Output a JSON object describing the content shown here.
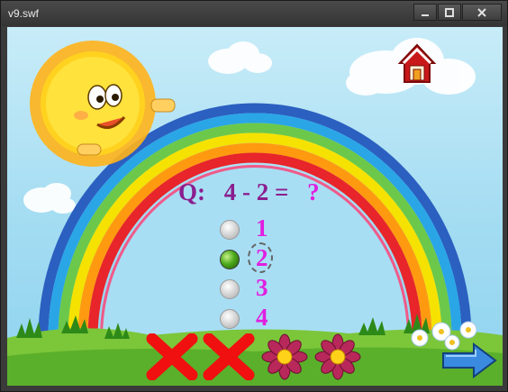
{
  "window": {
    "title": "v9.swf",
    "minimize_icon": "minimize-icon",
    "maximize_icon": "maximize-icon",
    "close_icon": "close-icon"
  },
  "question": {
    "prefix": "Q:",
    "expression": "4 - 2 =",
    "unknown": "?"
  },
  "options": [
    {
      "label": "1",
      "selected": false
    },
    {
      "label": "2",
      "selected": true
    },
    {
      "label": "3",
      "selected": false
    },
    {
      "label": "4",
      "selected": false
    }
  ],
  "progress": [
    {
      "state": "wrong",
      "icon": "red-x-icon"
    },
    {
      "state": "wrong",
      "icon": "red-x-icon"
    },
    {
      "state": "correct",
      "icon": "flower-icon"
    },
    {
      "state": "correct",
      "icon": "flower-icon"
    }
  ],
  "controls": {
    "home_icon": "home-icon",
    "next_icon": "next-arrow-icon"
  },
  "colors": {
    "question": "#8a1e8e",
    "option_text": "#e01fe0",
    "sky": "#a3dcf2"
  }
}
